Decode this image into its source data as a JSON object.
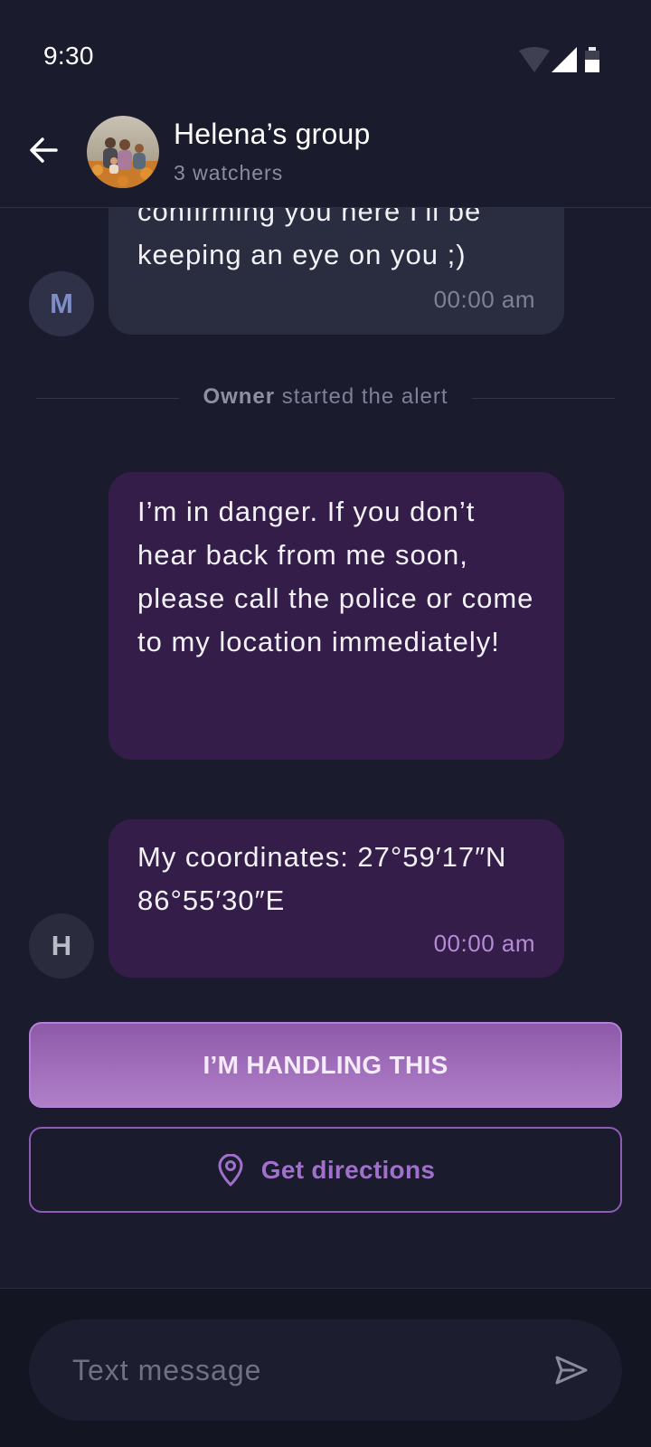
{
  "status_bar": {
    "time": "9:30"
  },
  "header": {
    "title": "Helena’s group",
    "subtitle": "3 watchers"
  },
  "messages": [
    {
      "sender_initial": "M",
      "text": "confirming you here I’ll be keeping an eye on you ;)",
      "time": "00:00 am"
    },
    {
      "text": "I’m in danger. If you don’t hear back from me soon, please call the police or come to my location immediately!"
    },
    {
      "sender_initial": "H",
      "text": "My coordinates: 27°59′17″N 86°55′30″E",
      "time": "00:00 am"
    }
  ],
  "system_event": {
    "actor": "Owner",
    "action": "started the alert"
  },
  "actions": {
    "handling_label": "I’M HANDLING THIS",
    "directions_label": "Get directions"
  },
  "composer": {
    "placeholder": "Text message"
  },
  "colors": {
    "background": "#1a1b2c",
    "bubble_gray": "#2a2c40",
    "bubble_purple": "#351d4a",
    "accent": "#a070cc"
  },
  "icons": [
    "wifi-icon",
    "signal-icon",
    "battery-icon",
    "back-arrow-icon",
    "location-pin-icon",
    "send-icon"
  ]
}
